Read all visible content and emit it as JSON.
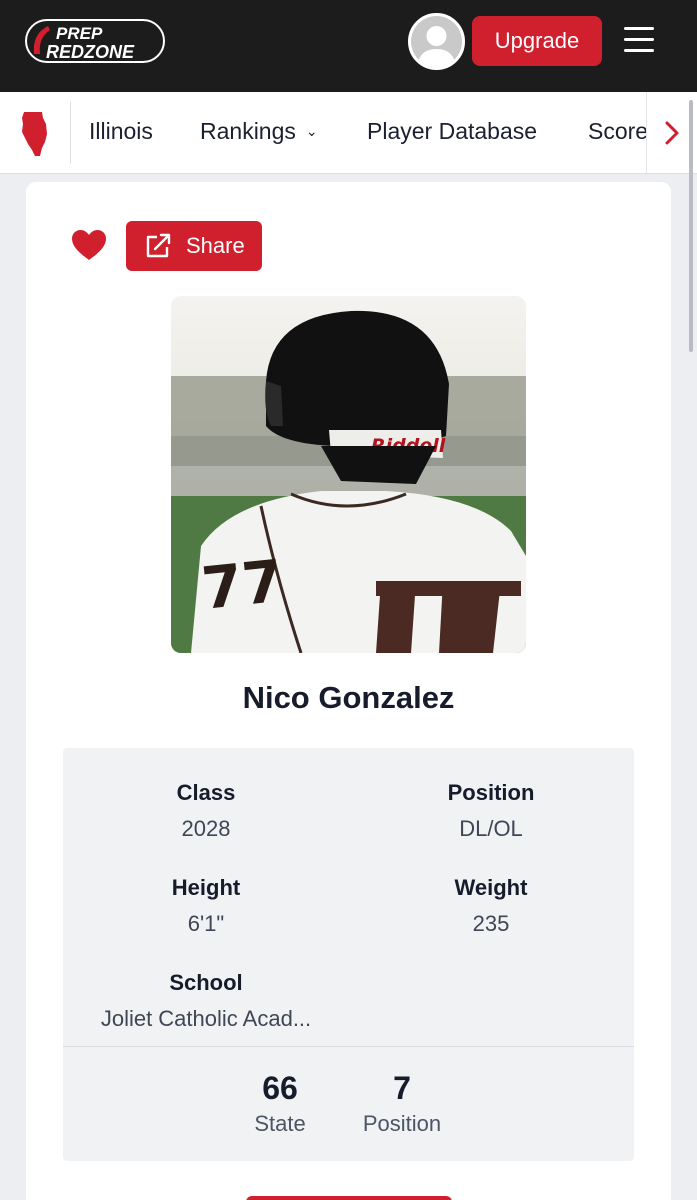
{
  "header": {
    "logo_top": "PREP",
    "logo_bottom": "REDZONE",
    "upgrade_label": "Upgrade"
  },
  "nav": {
    "items": [
      {
        "label": "Illinois"
      },
      {
        "label": "Rankings"
      },
      {
        "label": "Player Database"
      },
      {
        "label": "Score"
      }
    ]
  },
  "actions": {
    "share_label": "Share"
  },
  "photo": {
    "jersey_number": "77",
    "helmet_brand": "Riddell"
  },
  "player": {
    "name": "Nico Gonzalez",
    "fields": {
      "class": {
        "label": "Class",
        "value": "2028"
      },
      "position": {
        "label": "Position",
        "value": "DL/OL"
      },
      "height": {
        "label": "Height",
        "value": "6'1\""
      },
      "weight": {
        "label": "Weight",
        "value": "235"
      },
      "school": {
        "label": "School",
        "value": "Joliet Catholic Acad..."
      }
    },
    "rankings": {
      "state": {
        "value": "66",
        "label": "State"
      },
      "position": {
        "value": "7",
        "label": "Position"
      }
    }
  },
  "colors": {
    "brand_red": "#d0202e",
    "header_bg": "#1c1c1c"
  }
}
